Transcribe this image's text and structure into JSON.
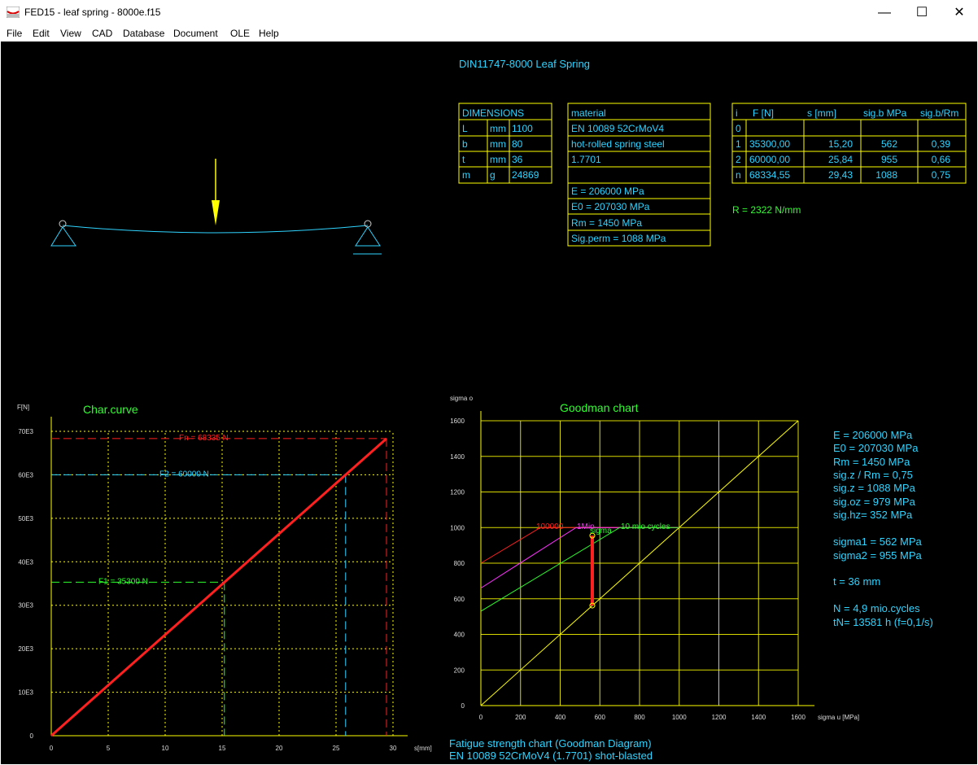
{
  "window": {
    "title": "FED15 - leaf spring  -  8000e.f15",
    "minimize_glyph": "—",
    "maximize_glyph": "☐",
    "close_glyph": "✕"
  },
  "menu": [
    "File",
    "Edit",
    "View",
    "CAD",
    "Database",
    "Document",
    "OLE",
    "Help"
  ],
  "header": {
    "title": "DIN11747-8000 Leaf Spring"
  },
  "dimensions": {
    "header": "DIMENSIONS",
    "rows": [
      [
        "L",
        "mm",
        "1100"
      ],
      [
        "b",
        "mm",
        "80"
      ],
      [
        "t",
        "mm",
        "36"
      ],
      [
        "m",
        "g",
        "24869"
      ]
    ]
  },
  "material": {
    "rows": [
      "material",
      "EN 10089 52CrMoV4",
      "hot-rolled spring steel",
      "1.7701",
      "",
      "E = 206000 MPa",
      "E0 = 207030 MPa",
      "Rm = 1450 MPa",
      "Sig.perm = 1088 MPa"
    ]
  },
  "loads": {
    "headers": [
      "i",
      "F [N]",
      "s [mm]",
      "sig.b MPa",
      "sig.b/Rm"
    ],
    "rows": [
      [
        "0",
        "",
        "",
        "",
        ""
      ],
      [
        "1",
        "35300,00",
        "15,20",
        "562",
        "0,39"
      ],
      [
        "2",
        "60000,00",
        "25,84",
        "955",
        "0,66"
      ],
      [
        "n",
        "68334,55",
        "29,43",
        "1088",
        "0,75"
      ]
    ],
    "rate": "R = 2322 N/mm"
  },
  "char_curve": {
    "title": "Char.curve",
    "y_axis_label": "F[N]",
    "x_axis_label": "s[mm]",
    "y_ticks": [
      "0",
      "10E3",
      "20E3",
      "30E3",
      "40E3",
      "50E3",
      "60E3",
      "70E3"
    ],
    "x_ticks": [
      "0",
      "5",
      "10",
      "15",
      "20",
      "25",
      "30"
    ],
    "markers": [
      {
        "label": "F1 = 35300 N",
        "color": "#2dff2d"
      },
      {
        "label": "F2 = 60000 N",
        "color": "#2fd4ff"
      },
      {
        "label": "Fn = 68335 N",
        "color": "#ff2020"
      }
    ]
  },
  "goodman": {
    "title": "Goodman chart",
    "y_axis_label": "sigma o",
    "x_axis_label": "sigma u [MPa]",
    "ticks": [
      "0",
      "200",
      "400",
      "600",
      "800",
      "1000",
      "1200",
      "1400",
      "1600"
    ],
    "line_labels": [
      {
        "label": "100000",
        "color": "#ff2020"
      },
      {
        "label": "1Mio",
        "color": "#ff30ff"
      },
      {
        "label": "10 mio cycles",
        "color": "#2dff2d"
      },
      {
        "label": "sigma",
        "color": "#2dff2d"
      }
    ],
    "results": [
      "E = 206000 MPa",
      "E0 = 207030 MPa",
      "Rm = 1450 MPa",
      "sig.z / Rm = 0,75",
      "sig.z = 1088 MPa",
      "sig.oz =  979 MPa",
      "sig.hz=  352 MPa",
      "",
      "sigma1 =  562 MPa",
      "sigma2 =  955 MPa",
      "",
      "t  = 36 mm",
      "",
      "N = 4,9 mio.cycles",
      "tN= 13581 h  (f=0,1/s)"
    ],
    "footer_1": "Fatigue strength chart (Goodman Diagram)",
    "footer_2": "EN 10089 52CrMoV4 (1.7701) shot-blasted"
  },
  "chart_data": [
    {
      "type": "line",
      "title": "Char.curve",
      "xlabel": "s[mm]",
      "ylabel": "F[N]",
      "xlim": [
        0,
        30
      ],
      "ylim": [
        0,
        70000
      ],
      "grid": true,
      "series": [
        {
          "name": "",
          "x": [
            0,
            29.43
          ],
          "y": [
            0,
            68334.55
          ]
        }
      ],
      "annotations": [
        {
          "text": "F1 = 35300 N",
          "x": 15.2,
          "y": 35300
        },
        {
          "text": "F2 = 60000 N",
          "x": 25.84,
          "y": 60000
        },
        {
          "text": "Fn = 68335 N",
          "x": 29.43,
          "y": 68334.55
        }
      ]
    },
    {
      "type": "line",
      "title": "Goodman chart",
      "xlabel": "sigma u [MPa]",
      "ylabel": "sigma o",
      "xlim": [
        0,
        1600
      ],
      "ylim": [
        0,
        1600
      ],
      "grid": true,
      "series": [
        {
          "name": "",
          "x": [
            0,
            1600
          ],
          "y": [
            0,
            1600
          ]
        },
        {
          "name": "100000",
          "x": [
            0,
            300,
            1000
          ],
          "y": [
            800,
            1000,
            1000
          ]
        },
        {
          "name": "1Mio",
          "x": [
            0,
            480,
            1000
          ],
          "y": [
            660,
            1000,
            1000
          ]
        },
        {
          "name": "10 mio cycles",
          "x": [
            0,
            700,
            1000
          ],
          "y": [
            530,
            1000,
            1000
          ]
        },
        {
          "name": "sigma",
          "x": [
            562,
            562
          ],
          "y": [
            562,
            955
          ]
        }
      ]
    }
  ]
}
